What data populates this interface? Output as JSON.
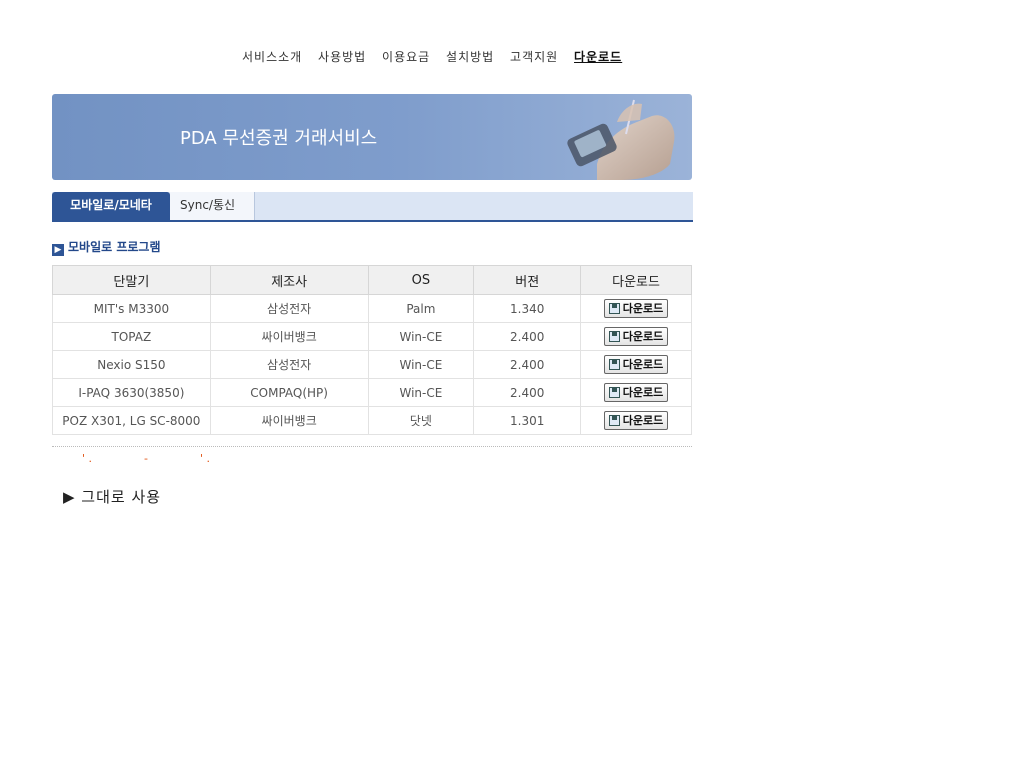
{
  "nav": {
    "items": [
      "서비스소개",
      "사용방법",
      "이용요금",
      "설치방법",
      "고객지원"
    ],
    "active": "다운로드"
  },
  "banner": {
    "title": "PDA 무선증권 거래서비스"
  },
  "tabs": {
    "active": "모바일로/모네타",
    "inactive": "Sync/통신"
  },
  "section": {
    "title": "모바일로 프로그램"
  },
  "table": {
    "headers": [
      "단말기",
      "제조사",
      "OS",
      "버젼",
      "다운로드"
    ],
    "rows": [
      [
        "MIT's M3300",
        "삼성전자",
        "Palm",
        "1.340"
      ],
      [
        "TOPAZ",
        "싸이버뱅크",
        "Win-CE",
        "2.400"
      ],
      [
        "Nexio S150",
        "삼성전자",
        "Win-CE",
        "2.400"
      ],
      [
        "I-PAQ 3630(3850)",
        "COMPAQ(HP)",
        "Win-CE",
        "2.400"
      ],
      [
        "POZ X301, LG SC-8000",
        "싸이버뱅크",
        "닷넷",
        "1.301"
      ]
    ],
    "download_label": "다운로드"
  },
  "note": {
    "text": "▶ 그대로 사용"
  },
  "colors": {
    "accent": "#2e5596",
    "banner": "#7292c3",
    "tabbar": "#dbe5f4"
  }
}
